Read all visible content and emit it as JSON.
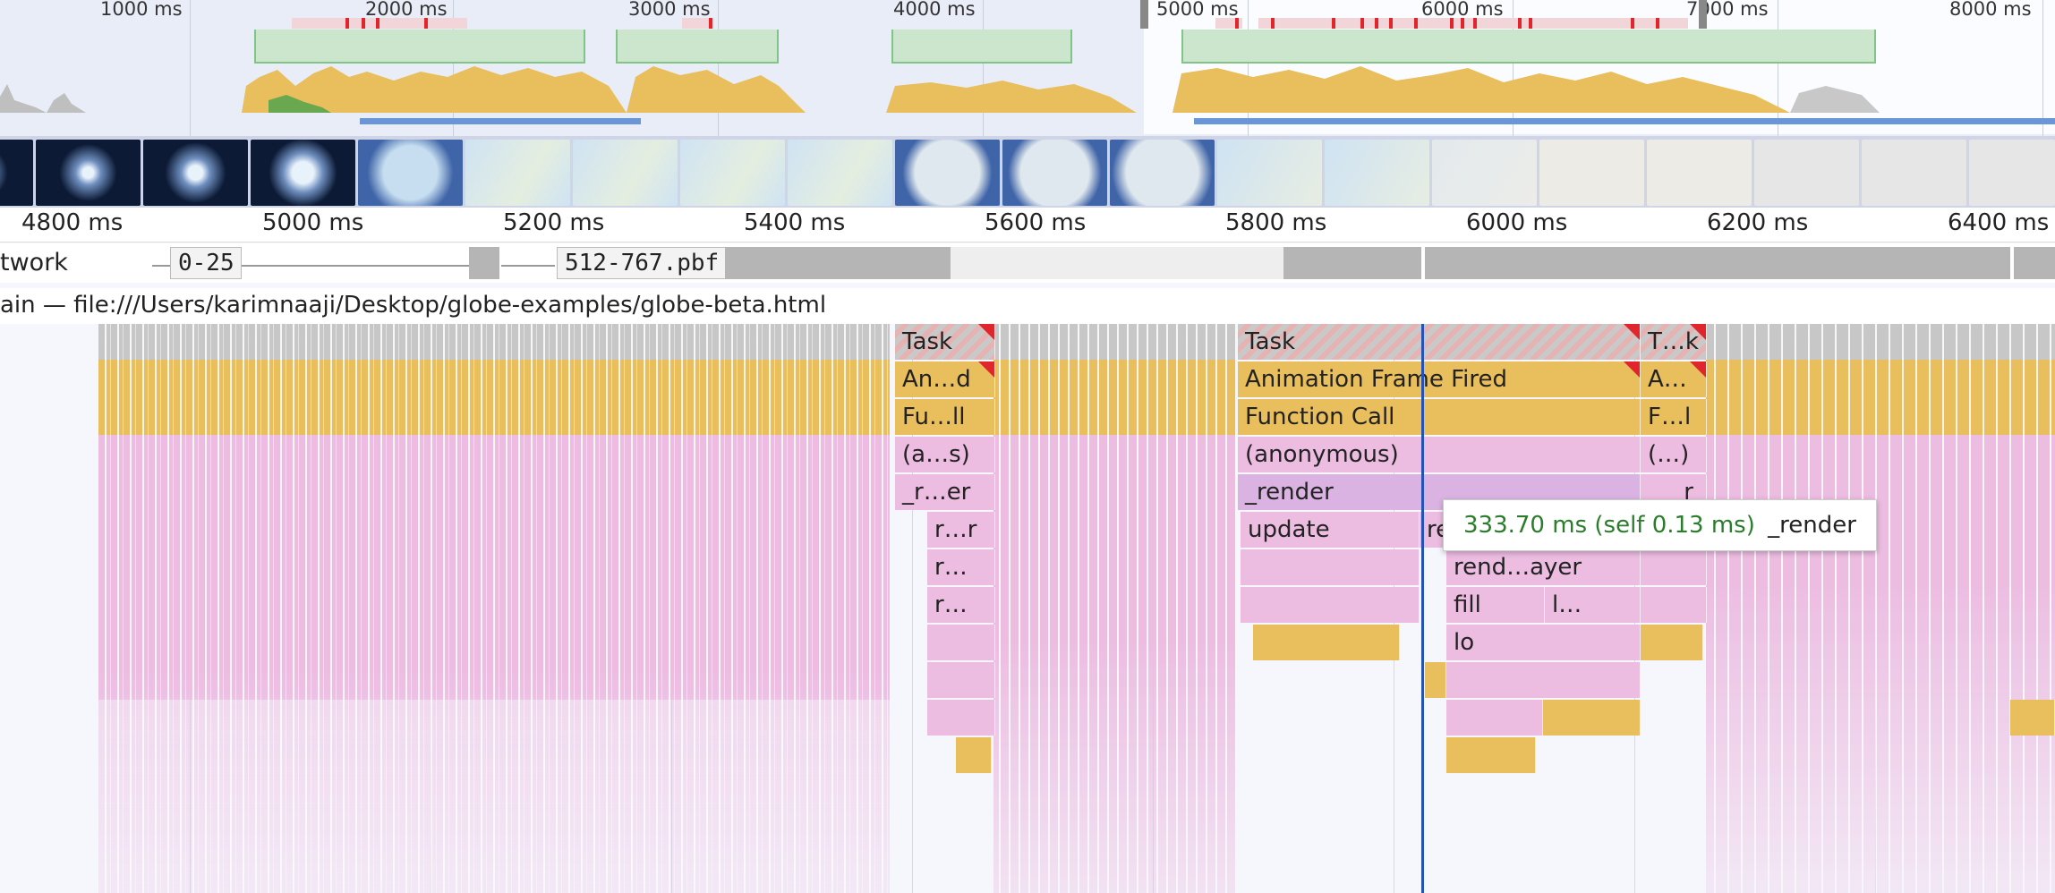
{
  "overview": {
    "tick_labels": [
      "1000 ms",
      "2000 ms",
      "3000 ms",
      "4000 ms",
      "5000 ms",
      "6000 ms",
      "7000 ms",
      "8000 ms"
    ]
  },
  "ruler": {
    "labels": [
      "4800 ms",
      "5000 ms",
      "5200 ms",
      "5400 ms",
      "5600 ms",
      "5800 ms",
      "6000 ms",
      "6200 ms",
      "6400 ms"
    ]
  },
  "network": {
    "title": "twork",
    "requests": [
      "0-25",
      "512-767.pbf"
    ]
  },
  "main": {
    "title": "ain — file:///Users/karimnaaji/Desktop/globe-examples/globe-beta.html"
  },
  "flame": {
    "labels": {
      "task_1": "Task",
      "task_2": "Task",
      "task_3": "T…k",
      "anim_1": "An…d",
      "anim_2": "Animation Frame Fired",
      "anim_3": "A…",
      "fn_1": "Fu…ll",
      "fn_2": "Function Call",
      "fn_3": "F…l",
      "anon_1": "(a…s)",
      "anon_2": "(anonymous)",
      "anon_3": "(…)",
      "render_1": "_r…er",
      "render_2": "_render",
      "render_3": "r",
      "r_1": "r…r",
      "update": "update",
      "re": "re",
      "r_2": "r…",
      "rend_layer": "rend…ayer",
      "r_3": "r…",
      "fill": "fill",
      "l": "l…",
      "lo": "lo"
    }
  },
  "tooltip": {
    "time": "333.70 ms (self 0.13 ms)",
    "name": "_render"
  },
  "colors": {
    "task": "#c7c7c7",
    "scripting": "#e9be5c",
    "js_call": "#ecbce1",
    "long_task_marker": "#e0262c",
    "cursor": "#2452b6",
    "tooltip_time": "#2a7d2a"
  }
}
